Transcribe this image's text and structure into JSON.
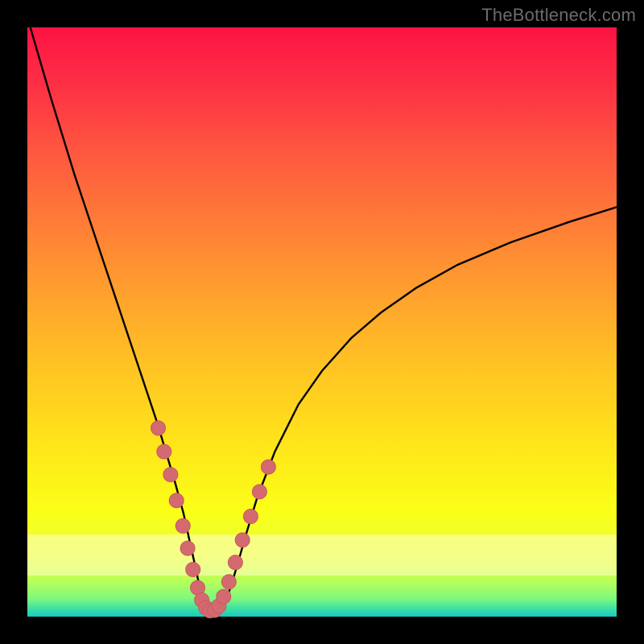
{
  "watermark": "TheBottleneck.com",
  "colors": {
    "curve_stroke": "#000000",
    "marker_fill": "#d46a6f",
    "marker_stroke": "#c65a60",
    "band_fill": "rgba(255,255,200,0.55)"
  },
  "chart_data": {
    "type": "line",
    "title": "",
    "xlabel": "",
    "ylabel": "",
    "xlim": [
      0,
      100
    ],
    "ylim": [
      0,
      100
    ],
    "grid": false,
    "legend": false,
    "highlight_band_y": [
      7,
      14
    ],
    "series": [
      {
        "name": "bottleneck-curve",
        "x": [
          0.5,
          4,
          8,
          12,
          15,
          18,
          20,
          22,
          23.5,
          25,
          26.5,
          27.5,
          28.5,
          29.3,
          30,
          30.7,
          31.3,
          32,
          32.8,
          33.6,
          34.5,
          35.7,
          37,
          39,
          42,
          46,
          50,
          55,
          60,
          66,
          73,
          82,
          92,
          100
        ],
        "y": [
          100,
          88,
          75,
          63,
          54,
          45,
          39,
          33,
          28,
          23,
          17.5,
          13,
          8.5,
          4.7,
          2.3,
          1.3,
          1.0,
          1.0,
          1.4,
          2.6,
          5.0,
          9.0,
          13.6,
          20.2,
          28.0,
          36.0,
          41.7,
          47.3,
          51.6,
          55.8,
          59.7,
          63.5,
          67.0,
          69.5
        ]
      }
    ],
    "markers": {
      "name": "highlighted-points",
      "x": [
        22.2,
        23.2,
        24.3,
        25.3,
        26.4,
        27.2,
        28.1,
        28.9,
        29.6,
        30.3,
        31.0,
        31.8,
        32.5,
        33.3,
        34.2,
        35.3,
        36.5,
        37.9,
        39.4,
        40.9
      ],
      "y": [
        32.0,
        28.0,
        24.1,
        19.7,
        15.4,
        11.6,
        8.0,
        4.9,
        2.8,
        1.5,
        1.0,
        1.1,
        1.8,
        3.4,
        5.9,
        9.2,
        13.0,
        17.0,
        21.2,
        25.4
      ],
      "radius": 9
    }
  }
}
